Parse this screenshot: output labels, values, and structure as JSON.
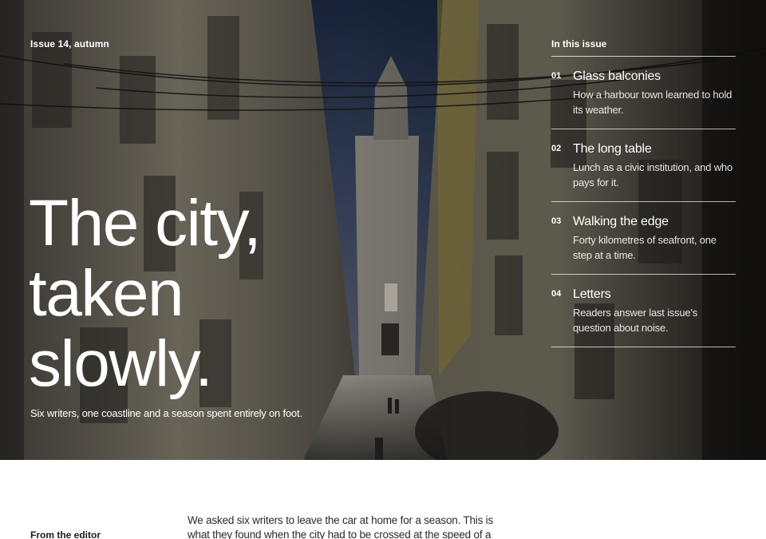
{
  "hero": {
    "issue": "Issue 14, autumn",
    "title_lines": [
      "The city,",
      "taken",
      "slowly."
    ],
    "subtitle": "Six writers, one coastline and a season spent entirely on foot."
  },
  "toc": {
    "heading": "In this issue",
    "items": [
      {
        "number": "01",
        "title": "Glass balconies",
        "description": "How a harbour town learned to hold its weather."
      },
      {
        "number": "02",
        "title": "The long table",
        "description": "Lunch as a civic institution, and who pays for it."
      },
      {
        "number": "03",
        "title": "Walking the edge",
        "description": "Forty kilometres of seafront, one step at a time."
      },
      {
        "number": "04",
        "title": "Letters",
        "description": "Readers answer last issue's question about noise."
      }
    ]
  },
  "editor": {
    "label": "From the editor",
    "text": "We asked six writers to leave the car at home for a season. This is what they found when the city had to be crossed at the speed of a"
  },
  "colors": {
    "text_on_photo": "#ffffff",
    "body_text": "#2a2a2a",
    "background": "#ffffff"
  }
}
